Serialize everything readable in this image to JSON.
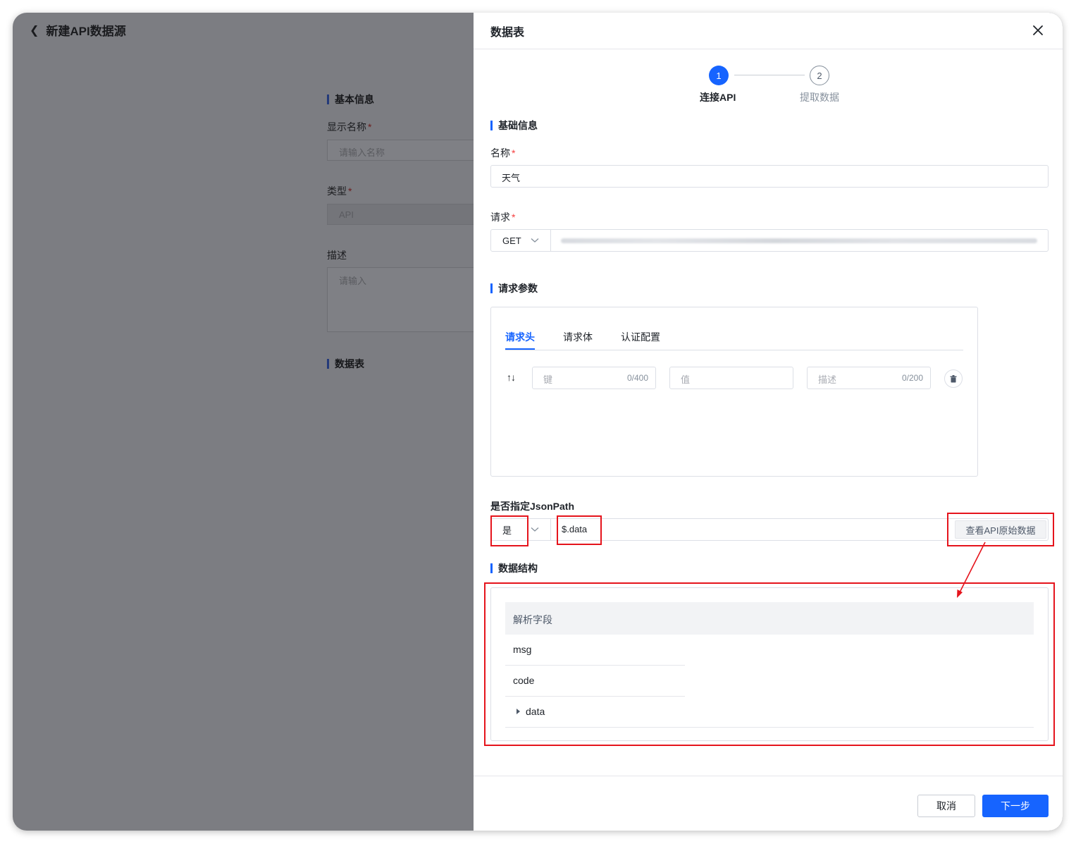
{
  "background_page": {
    "title": "新建API数据源",
    "section_basic": "基本信息",
    "display_name_label": "显示名称",
    "display_name_placeholder": "请输入名称",
    "type_label": "类型",
    "type_value": "API",
    "desc_label": "描述",
    "desc_placeholder": "请输入",
    "section_table": "数据表",
    "required_mark": "*"
  },
  "drawer": {
    "title": "数据表",
    "steps": [
      {
        "number": "1",
        "label": "连接API",
        "active": true
      },
      {
        "number": "2",
        "label": "提取数据",
        "active": false
      }
    ],
    "basic_section": "基础信息",
    "name_label": "名称",
    "name_value": "天气",
    "request_label": "请求",
    "method_value": "GET",
    "required_mark": "*",
    "params_section": "请求参数",
    "tabs": [
      "请求头",
      "请求体",
      "认证配置"
    ],
    "header_row": {
      "key_placeholder": "键",
      "key_count": "0/400",
      "value_placeholder": "值",
      "desc_placeholder": "描述",
      "desc_count": "0/200"
    },
    "jsonpath_label": "是否指定JsonPath",
    "jsonpath_select": "是",
    "jsonpath_value": "$.data",
    "view_raw_button": "查看API原始数据",
    "structure_section": "数据结构",
    "structure_header": "解析字段",
    "structure_rows": [
      "msg",
      "code",
      "data"
    ],
    "cancel_button": "取消",
    "next_button": "下一步"
  },
  "colors": {
    "accent": "#1664ff",
    "annotation": "#e5141c",
    "overlay": "#7c7d82"
  }
}
